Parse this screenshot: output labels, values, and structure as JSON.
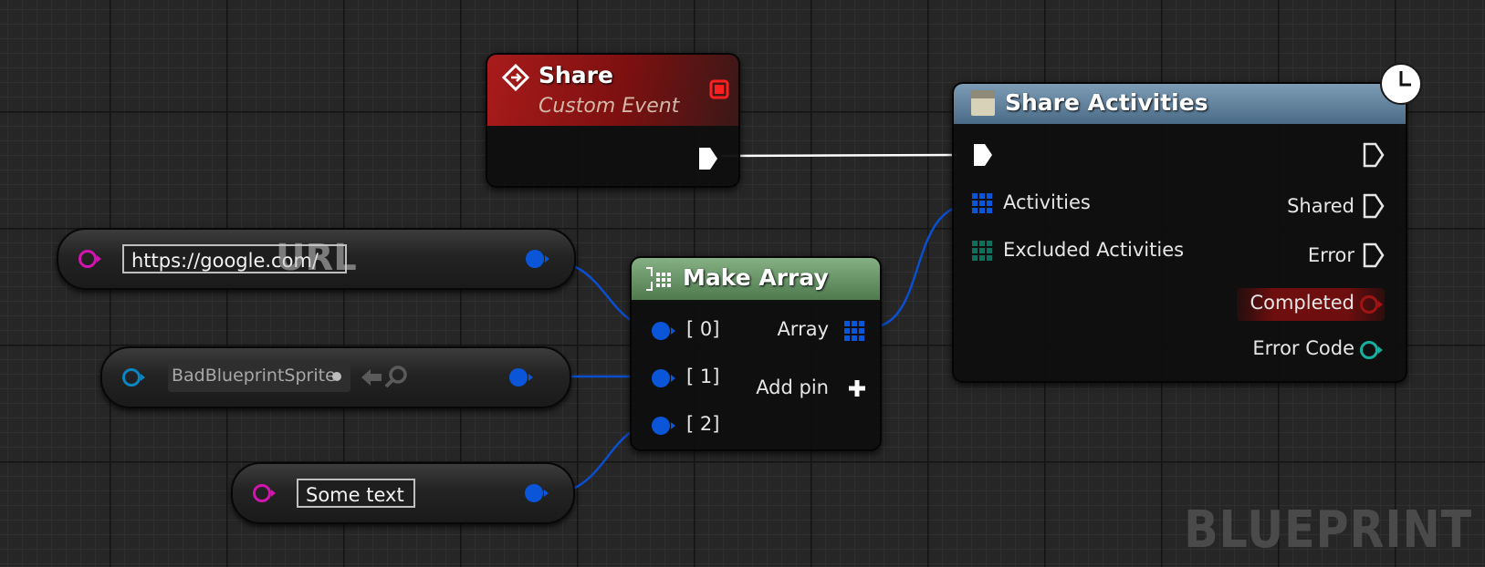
{
  "share_event": {
    "title": "Share",
    "subtitle": "Custom Event",
    "header_color": "#8e1616"
  },
  "share_activities": {
    "title": "Share Activities",
    "header_color": "#5f7f98",
    "inputs": [
      "Activities",
      "Excluded Activities"
    ],
    "outputs": [
      "Shared",
      "Error",
      "Completed",
      "Error Code"
    ]
  },
  "make_array": {
    "title": "Make Array",
    "header_color": "#5f8d5f",
    "inputs": [
      "[ 0]",
      "[ 1]",
      "[ 2]"
    ],
    "output": "Array",
    "add_pin": "Add pin"
  },
  "url_literal": {
    "value": "https://google.com/",
    "watermark": "URL"
  },
  "sprite_literal": {
    "value": "BadBlueprintSprite"
  },
  "text_literal": {
    "value": "Some text"
  },
  "watermark": "BLUEPRINT",
  "colors": {
    "pin_object": "#0a55d8",
    "pin_text": "#d214b0",
    "pin_struct": "#0c86c0",
    "pin_completed": "#8a1010",
    "pin_error_code": "#13b0a0",
    "wire": "#0a4fd0",
    "exec_wire": "#ffffff"
  }
}
